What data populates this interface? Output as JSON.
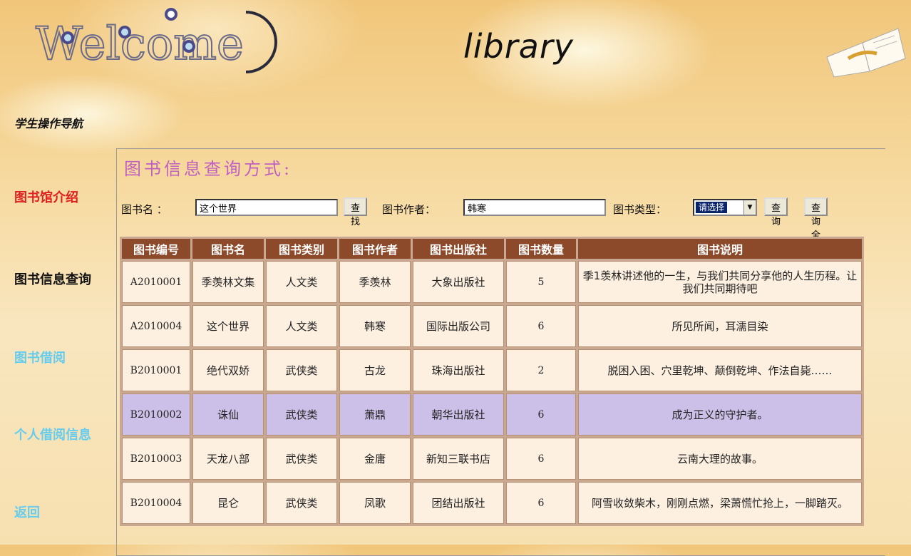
{
  "header": {
    "logo_text": "Welcome",
    "site_title": "library"
  },
  "nav": {
    "heading": "学生操作导航",
    "items": [
      {
        "label": "图书馆介绍",
        "color": "#e02020"
      },
      {
        "label": "图书信息查询",
        "color": "#111111"
      },
      {
        "label": "图书借阅",
        "color": "#66ccee"
      },
      {
        "label": "个人借阅信息",
        "color": "#66ccee"
      },
      {
        "label": "返回",
        "color": "#66ccee"
      }
    ]
  },
  "search": {
    "title": "图书信息查询方式:",
    "book_name_label": "图书名 ：",
    "book_name_value": "这个世界",
    "find_button": "查找",
    "author_label": "图书作者：",
    "author_value": "韩寒",
    "type_label": "图书类型：",
    "type_selected": "请选择",
    "query_button": "查询",
    "query_all_button": "查询全部"
  },
  "table": {
    "headers": [
      "图书编号",
      "图书名",
      "图书类别",
      "图书作者",
      "图书出版社",
      "图书数量",
      "图书说明"
    ],
    "rows": [
      {
        "id": "A2010001",
        "name": "季羡林文集",
        "category": "人文类",
        "author": "季羡林",
        "publisher": "大象出版社",
        "qty": "5",
        "desc": "季1羡林讲述他的一生，与我们共同分享他的人生历程。让我们共同期待吧"
      },
      {
        "id": "A2010004",
        "name": "这个世界",
        "category": "人文类",
        "author": "韩寒",
        "publisher": "国际出版公司",
        "qty": "6",
        "desc": "所见所闻，耳濡目染"
      },
      {
        "id": "B2010001",
        "name": "绝代双娇",
        "category": "武侠类",
        "author": "古龙",
        "publisher": "珠海出版社",
        "qty": "2",
        "desc": "脱困入困、穴里乾坤、颠倒乾坤、作法自毙……"
      },
      {
        "id": "B2010002",
        "name": "诛仙",
        "category": "武侠类",
        "author": "萧鼎",
        "publisher": "朝华出版社",
        "qty": "6",
        "desc": "成为正义的守护者。"
      },
      {
        "id": "B2010003",
        "name": "天龙八部",
        "category": "武侠类",
        "author": "金庸",
        "publisher": "新知三联书店",
        "qty": "6",
        "desc": "云南大理的故事。"
      },
      {
        "id": "B2010004",
        "name": "昆仑",
        "category": "武侠类",
        "author": "凤歌",
        "publisher": "团结出版社",
        "qty": "6",
        "desc": "阿雪收敛柴木，刚刚点燃，梁萧慌忙抢上，一脚踏灭。"
      }
    ],
    "highlight_color": "#ccc0e8",
    "header_color": "#8d4a2a"
  }
}
